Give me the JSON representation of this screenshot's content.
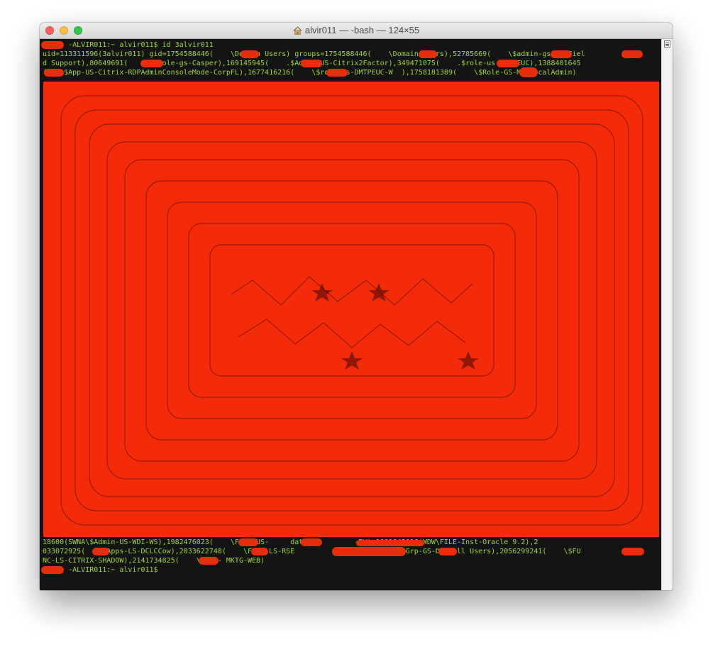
{
  "window": {
    "title": "alvir011 — -bash — 124×55",
    "home_icon": "house-icon"
  },
  "terminal": {
    "text_color": "#9fd83a",
    "background": "#141414",
    "redaction_color": "#f42b09",
    "top_lines": [
      "      -ALVIR011:~ alvir011$ id 3alvir011",
      "uid=113311596(3alvir011) gid=1754588446(    \\Domain Users) groups=1754588446(    \\Domain Users),52785669(    \\$admin-gs    Fiel",
      "d Support),80649691(     \\$role-gs-Casper),169145945(    .$Admin-US-Citrix2Factor),349471075(    .$role-us-DMTPEUC),1388401645",
      "(    $App-US-Citrix-RDPAdminConsoleMode-CorpFL),1677416216(    \\$role-gs-DMTPEUC-W  ),1758181389(    \\$Role-GS-MacLocalAdmin)"
    ],
    "bottom_lines": [
      "18600(SWNA\\$Admin-US-WDI-WS),1982476023(    \\File-US-     data-          -RW),1991643016(WDW\\FILE-Inst-Oracle 9.2),2",
      "033072925(    \\Apps-LS-DCLCCow),2033622748(    \\File-LS-RSE         ),2045009855(    Grp-GS-DCL All Users),2056299241(    \\$FU",
      "NC-LS-CITRIX-SHADOW),2141734825(    \\Web - MKTG-WEB)",
      "      -ALVIR011:~ alvir011$ "
    ]
  }
}
